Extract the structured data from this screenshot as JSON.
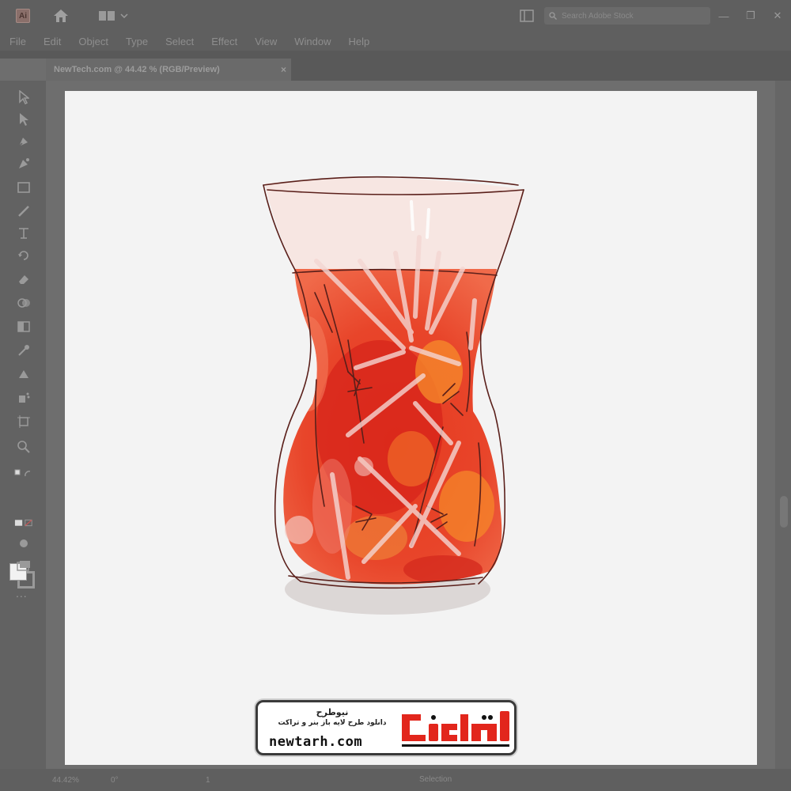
{
  "window": {
    "app_icon": "illustrator-logo",
    "search_placeholder": "Search Adobe Stock",
    "controls": [
      "minimize-icon",
      "restore-icon",
      "close-icon"
    ]
  },
  "menu": {
    "items": [
      "File",
      "Edit",
      "Object",
      "Type",
      "Select",
      "Effect",
      "View",
      "Window",
      "Help"
    ]
  },
  "document_tab": {
    "label": "NewTech.com @ 44.42 % (RGB/Preview)",
    "close": "×"
  },
  "toolbar": {
    "tools": [
      "selection-icon",
      "direct-selection-icon",
      "pen-icon",
      "curvature-icon",
      "rectangle-icon",
      "paintbrush-icon",
      "type-icon",
      "rotate-icon",
      "eraser-icon",
      "shape-builder-icon",
      "gradient-icon",
      "eyedropper-icon",
      "blend-icon",
      "symbol-sprayer-icon",
      "artboard-icon",
      "zoom-icon"
    ],
    "more": "..."
  },
  "statusbar": {
    "zoom": "44.42%",
    "angle": "0°",
    "page": "1",
    "tool": "Selection"
  },
  "watermark": {
    "title": "نیوطرح",
    "subtitle": "دانلود طرح لایه باز بنر و تراکت",
    "url": "newtarh.com",
    "logo_text": "نیوطرح"
  },
  "colors": {
    "tea_dark": "#d42a1a",
    "tea_mid": "#ee4a2a",
    "tea_orange": "#f5872a",
    "glass_outline": "#5a1f1a",
    "watermark_red": "#e2261c"
  }
}
